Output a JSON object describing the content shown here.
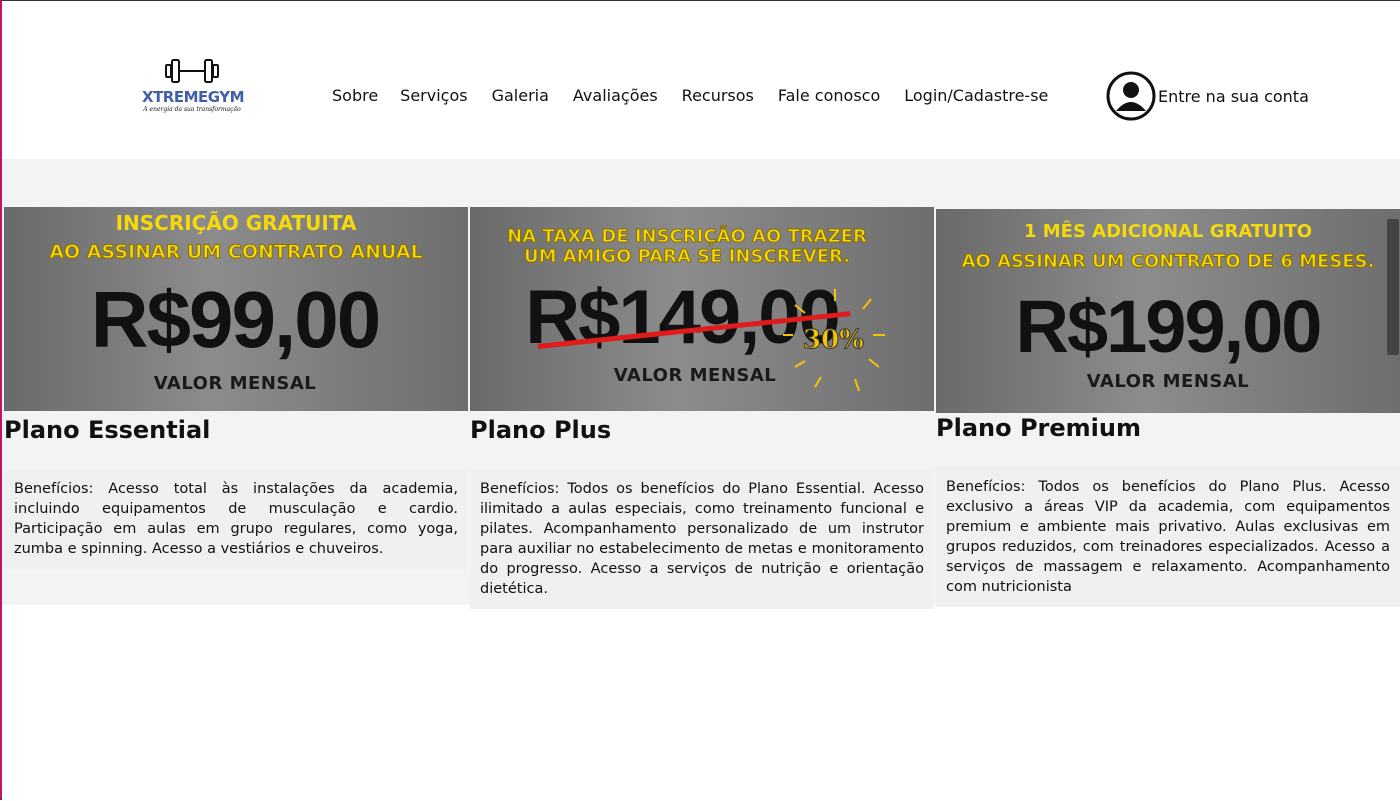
{
  "brand": {
    "name": "XTREMEGYM",
    "tagline": "A energia da sua transformação"
  },
  "nav": {
    "items": [
      "Sobre",
      "Serviços",
      "Galeria",
      "Avaliações",
      "Recursos",
      "Fale conosco",
      "Login/Cadastre-se"
    ]
  },
  "account": {
    "label": "Entre na sua conta",
    "icon": "user-circle-icon"
  },
  "colors": {
    "promo_yellow": "#f5d90a",
    "strike_red": "#e01b1b",
    "section_bg": "#f3f3f3"
  },
  "plans": [
    {
      "promo_line1": "INSCRIÇÃO GRATUITA",
      "promo_line2": "AO ASSINAR UM CONTRATO ANUAL",
      "price": "R$99,00",
      "price_label": "VALOR MENSAL",
      "title": "Plano Essential",
      "benefits": "Benefícios: Acesso total às instalações da academia, incluindo equipamentos de musculação e cardio. Participação em aulas em grupo regulares, como yoga, zumba e spinning. Acesso a vestiários e chuveiros."
    },
    {
      "promo_line1": "NA TAXA DE INSCRIÇÃO AO TRAZER",
      "promo_line2": "UM AMIGO PARA SE INSCREVER.",
      "price": "R$149,00",
      "price_label": "VALOR MENSAL",
      "discount": "30%",
      "title": "Plano Plus",
      "benefits": "Benefícios: Todos os benefícios do Plano Essential. Acesso ilimitado a aulas especiais, como treinamento funcional e pilates. Acompanhamento personalizado de um instrutor para auxiliar no estabelecimento de metas e monitoramento do progresso. Acesso a serviços de nutrição e orientação dietética."
    },
    {
      "promo_line1": "1 MÊS ADICIONAL GRATUITO",
      "promo_line2": "AO ASSINAR UM CONTRATO DE 6 MESES.",
      "price": "R$199,00",
      "price_label": "VALOR MENSAL",
      "title": "Plano Premium",
      "benefits": "Benefícios: Todos os benefícios do Plano Plus. Acesso exclusivo a áreas VIP da academia, com equipamentos premium e ambiente mais privativo. Aulas exclusivas em grupos reduzidos, com treinadores especializados. Acesso a serviços de massagem e relaxamento. Acompanhamento com nutricionista"
    }
  ]
}
